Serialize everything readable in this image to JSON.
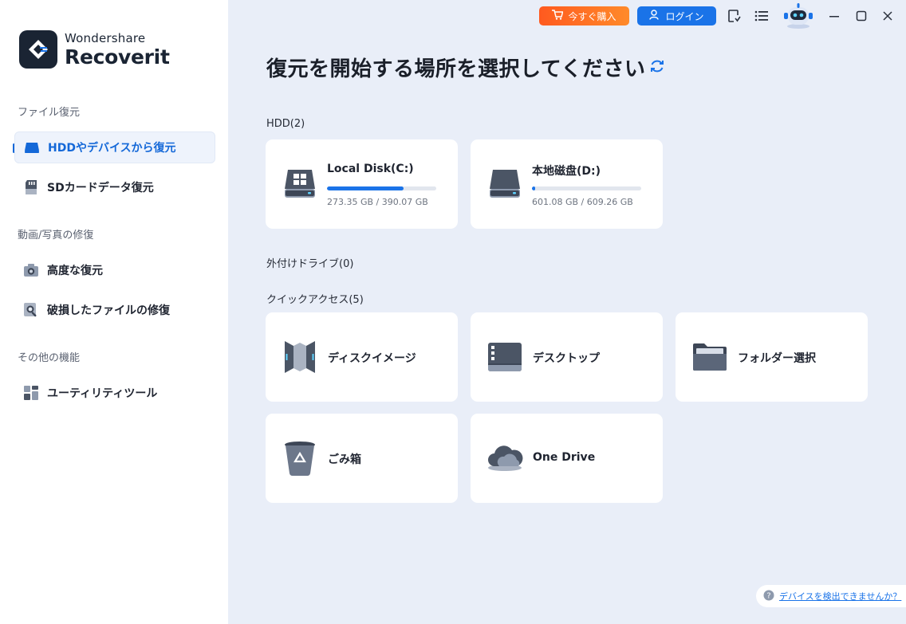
{
  "app": {
    "brand": "Wondershare",
    "product": "Recoverit"
  },
  "colors": {
    "accent": "#1a73e8",
    "buy_orange": "#ff6a23",
    "sidebar_bg": "#ffffff",
    "main_bg": "#e9eef8"
  },
  "topbar": {
    "buy_label": "今すぐ購入",
    "login_label": "ログイン",
    "icons": [
      "cart-icon",
      "user-icon",
      "update-icon",
      "menu-icon",
      "robot-avatar",
      "minimize-icon",
      "maximize-icon",
      "close-icon"
    ]
  },
  "sidebar": {
    "sections": [
      {
        "label": "ファイル復元",
        "items": [
          {
            "label": "HDDやデバイスから復元",
            "icon": "hdd-icon",
            "active": true
          },
          {
            "label": "SDカードデータ復元",
            "icon": "sd-card-icon",
            "active": false
          }
        ]
      },
      {
        "label": "動画/写真の修復",
        "items": [
          {
            "label": "高度な復元",
            "icon": "camera-icon",
            "active": false
          },
          {
            "label": "破損したファイルの修復",
            "icon": "repair-search-icon",
            "active": false
          }
        ]
      },
      {
        "label": "その他の機能",
        "items": [
          {
            "label": "ユーティリティツール",
            "icon": "utility-grid-icon",
            "active": false
          }
        ]
      }
    ]
  },
  "main": {
    "title": "復元を開始する場所を選択してください",
    "hdd": {
      "label": "HDD(2)",
      "drives": [
        {
          "name": "Local Disk(C:)",
          "size": "273.35 GB / 390.07 GB",
          "used_fraction": 0.7,
          "icon": "windows-drive-icon"
        },
        {
          "name": "本地磁盘(D:)",
          "size": "601.08 GB / 609.26 GB",
          "used_fraction": 0.03,
          "icon": "drive-icon"
        }
      ]
    },
    "external": {
      "label": "外付けドライブ(0)"
    },
    "quick_access": {
      "label": "クイックアクセス(5)",
      "items": [
        {
          "label": "ディスクイメージ",
          "icon": "disk-image-icon"
        },
        {
          "label": "デスクトップ",
          "icon": "desktop-icon"
        },
        {
          "label": "フォルダー選択",
          "icon": "folder-icon"
        },
        {
          "label": "ごみ箱",
          "icon": "recycle-bin-icon"
        },
        {
          "label": "One Drive",
          "icon": "onedrive-cloud-icon"
        }
      ]
    }
  },
  "help": {
    "label": "デバイスを検出できませんか？"
  }
}
